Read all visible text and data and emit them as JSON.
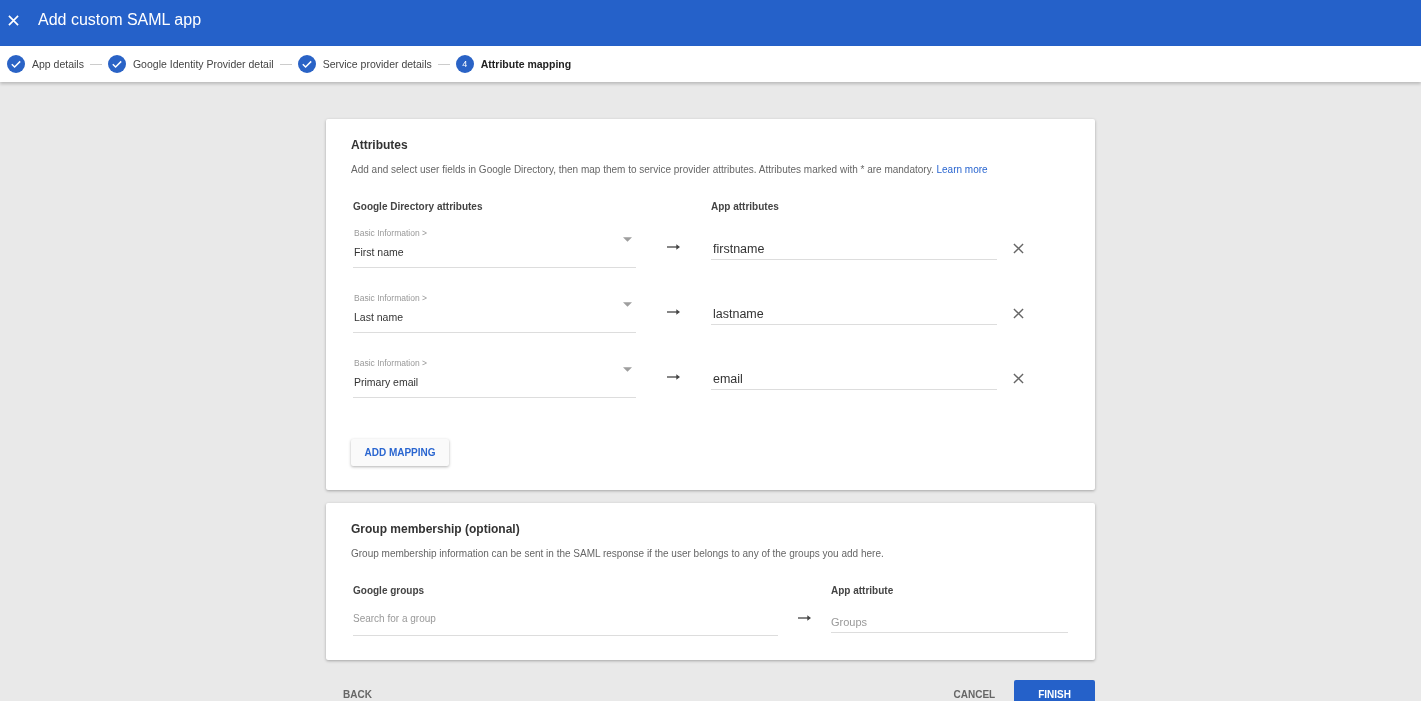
{
  "header": {
    "title": "Add custom SAML app"
  },
  "stepper": [
    {
      "label": "App details",
      "completed": true,
      "selected": false
    },
    {
      "label": "Google Identity Provider detail",
      "completed": true,
      "selected": false
    },
    {
      "label": "Service provider details",
      "completed": true,
      "selected": false
    },
    {
      "label": "Attribute mapping",
      "number": "4",
      "completed": false,
      "selected": true
    }
  ],
  "attributes_card": {
    "title": "Attributes",
    "description": "Add and select user fields in Google Directory, then map them to service provider attributes. Attributes marked with * are mandatory.",
    "link": "Learn more",
    "directory_header": "Google Directory attributes",
    "app_header": "App attributes",
    "mappings": [
      {
        "category": "Basic Information >",
        "directory_value": "First name",
        "app_value": "firstname"
      },
      {
        "category": "Basic Information >",
        "directory_value": "Last name",
        "app_value": "lastname"
      },
      {
        "category": "Basic Information >",
        "directory_value": "Primary email",
        "app_value": "email"
      }
    ],
    "add_button": "ADD MAPPING"
  },
  "group_card": {
    "title": "Group membership (optional)",
    "description": "Group membership information can be sent in the SAML response if the user belongs to any of the groups you add here.",
    "groups_header": "Google groups",
    "app_header": "App attribute",
    "groups_field": {
      "placeholder": "Search for a group"
    },
    "app_field": {
      "placeholder": "Groups"
    }
  },
  "footer": {
    "back": "BACK",
    "cancel": "CANCEL",
    "finish": "FINISH"
  }
}
